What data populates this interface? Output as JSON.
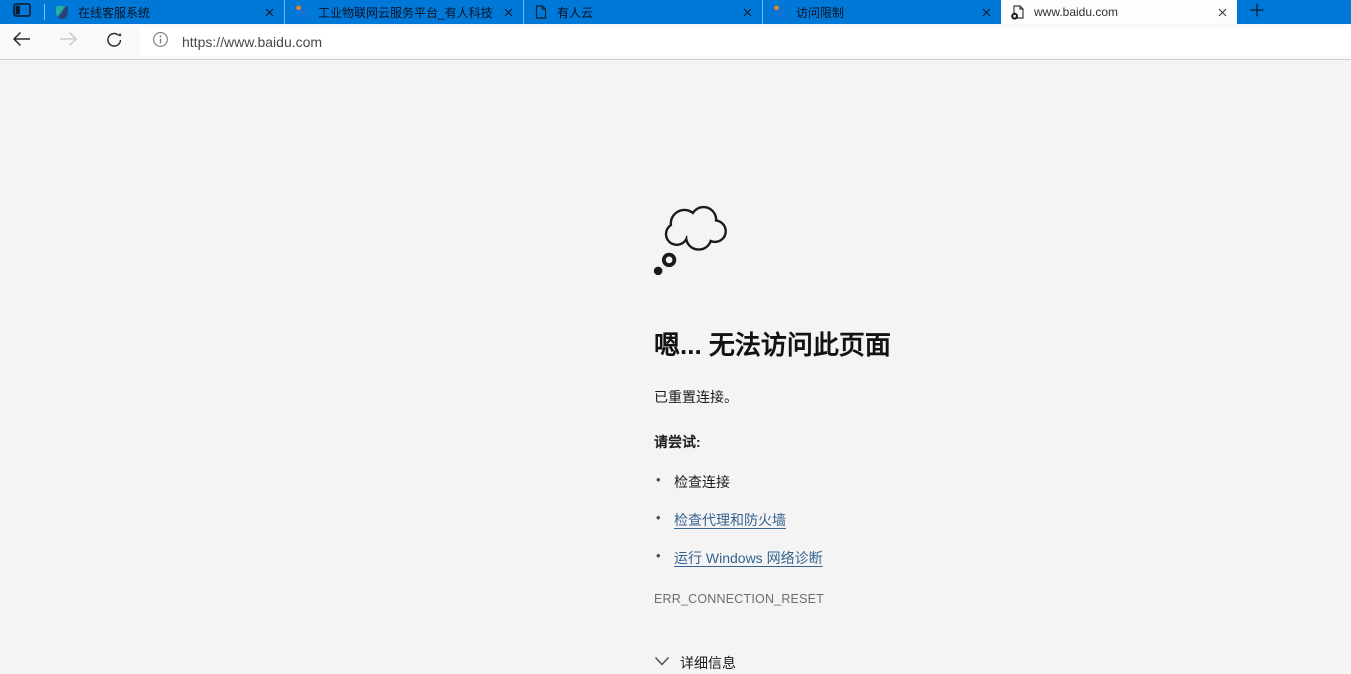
{
  "browser": {
    "tab_bar": {
      "tabs": [
        {
          "title": "在线客服系统",
          "icon": "shield-favicon",
          "active": false
        },
        {
          "title": "工业物联网云服务平台_有人科技",
          "icon": "usr-logo-favicon",
          "active": false
        },
        {
          "title": "有人云",
          "icon": "page-favicon",
          "active": false
        },
        {
          "title": "访问限制",
          "icon": "usr-logo-favicon",
          "active": false
        },
        {
          "title": "www.baidu.com",
          "icon": "page-error-favicon",
          "active": true
        }
      ]
    },
    "nav": {
      "url": "https://www.baidu.com"
    }
  },
  "error_page": {
    "title": "嗯... 无法访问此页面",
    "message": "已重置连接。",
    "suggestion_header": "请尝试:",
    "suggestions": [
      {
        "label": "检查连接",
        "is_link": false
      },
      {
        "label": "检查代理和防火墙",
        "is_link": true
      },
      {
        "label": "运行 Windows 网络诊断",
        "is_link": true
      }
    ],
    "error_code": "ERR_CONNECTION_RESET",
    "details_label": "详细信息"
  },
  "icons": {
    "tab_preview": "tab-preview",
    "close": "✕",
    "new_tab": "+",
    "back": "←",
    "forward": "→",
    "refresh": "↻",
    "info": "ⓘ",
    "thought_bubble": "thought-bubble",
    "chevron_down": "⌄",
    "bullet": "•"
  },
  "colors": {
    "accent_blue": "#0078d7",
    "active_tab_bg": "#fdfdfd",
    "page_bg": "#f4f4f4",
    "link": "#36638f",
    "error_code_gray": "#6e6e6e"
  }
}
